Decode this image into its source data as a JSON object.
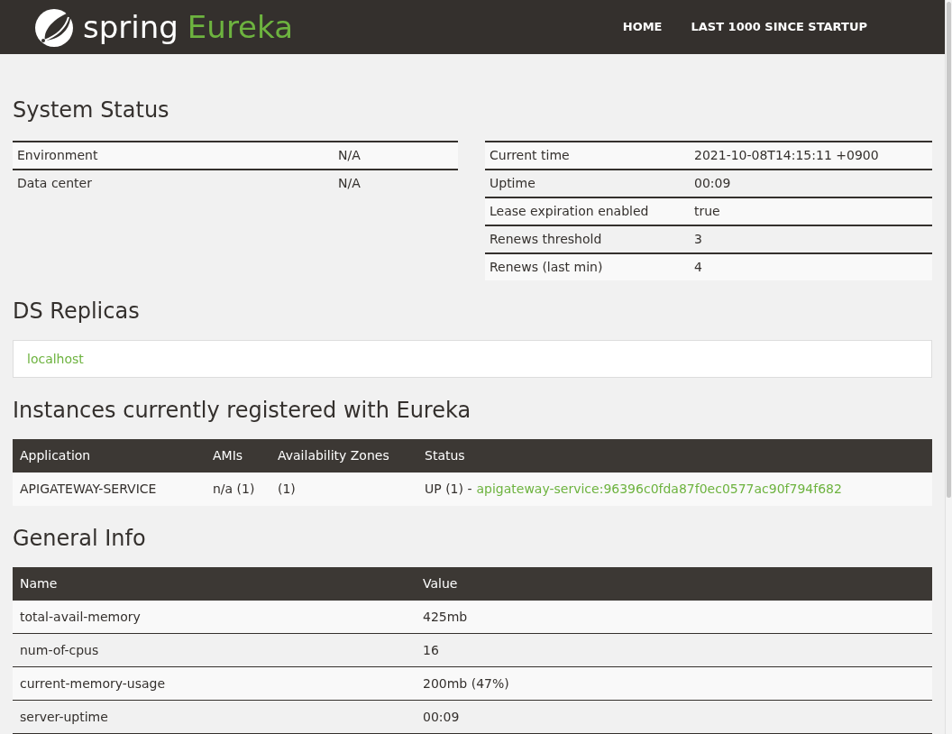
{
  "header": {
    "brand": "spring",
    "product": "Eureka",
    "nav": [
      "HOME",
      "LAST 1000 SINCE STARTUP"
    ]
  },
  "system_status": {
    "title": "System Status",
    "left": [
      {
        "label": "Environment",
        "value": "N/A"
      },
      {
        "label": "Data center",
        "value": "N/A"
      }
    ],
    "right": [
      {
        "label": "Current time",
        "value": "2021-10-08T14:15:11 +0900"
      },
      {
        "label": "Uptime",
        "value": "00:09"
      },
      {
        "label": "Lease expiration enabled",
        "value": "true"
      },
      {
        "label": "Renews threshold",
        "value": "3"
      },
      {
        "label": "Renews (last min)",
        "value": "4"
      }
    ]
  },
  "ds_replicas": {
    "title": "DS Replicas",
    "replicas": [
      "localhost"
    ]
  },
  "instances": {
    "title": "Instances currently registered with Eureka",
    "columns": [
      "Application",
      "AMIs",
      "Availability Zones",
      "Status"
    ],
    "rows": [
      {
        "application": "APIGATEWAY-SERVICE",
        "amis": "n/a (1)",
        "zones": "(1)",
        "status": "UP (1) -",
        "instance_link": "apigateway-service:96396c0fda87f0ec0577ac90f794f682"
      }
    ]
  },
  "general_info": {
    "title": "General Info",
    "columns": [
      "Name",
      "Value"
    ],
    "rows": [
      {
        "name": "total-avail-memory",
        "value": "425mb"
      },
      {
        "name": "num-of-cpus",
        "value": "16"
      },
      {
        "name": "current-memory-usage",
        "value": "200mb (47%)"
      },
      {
        "name": "server-uptime",
        "value": "00:09"
      }
    ]
  }
}
